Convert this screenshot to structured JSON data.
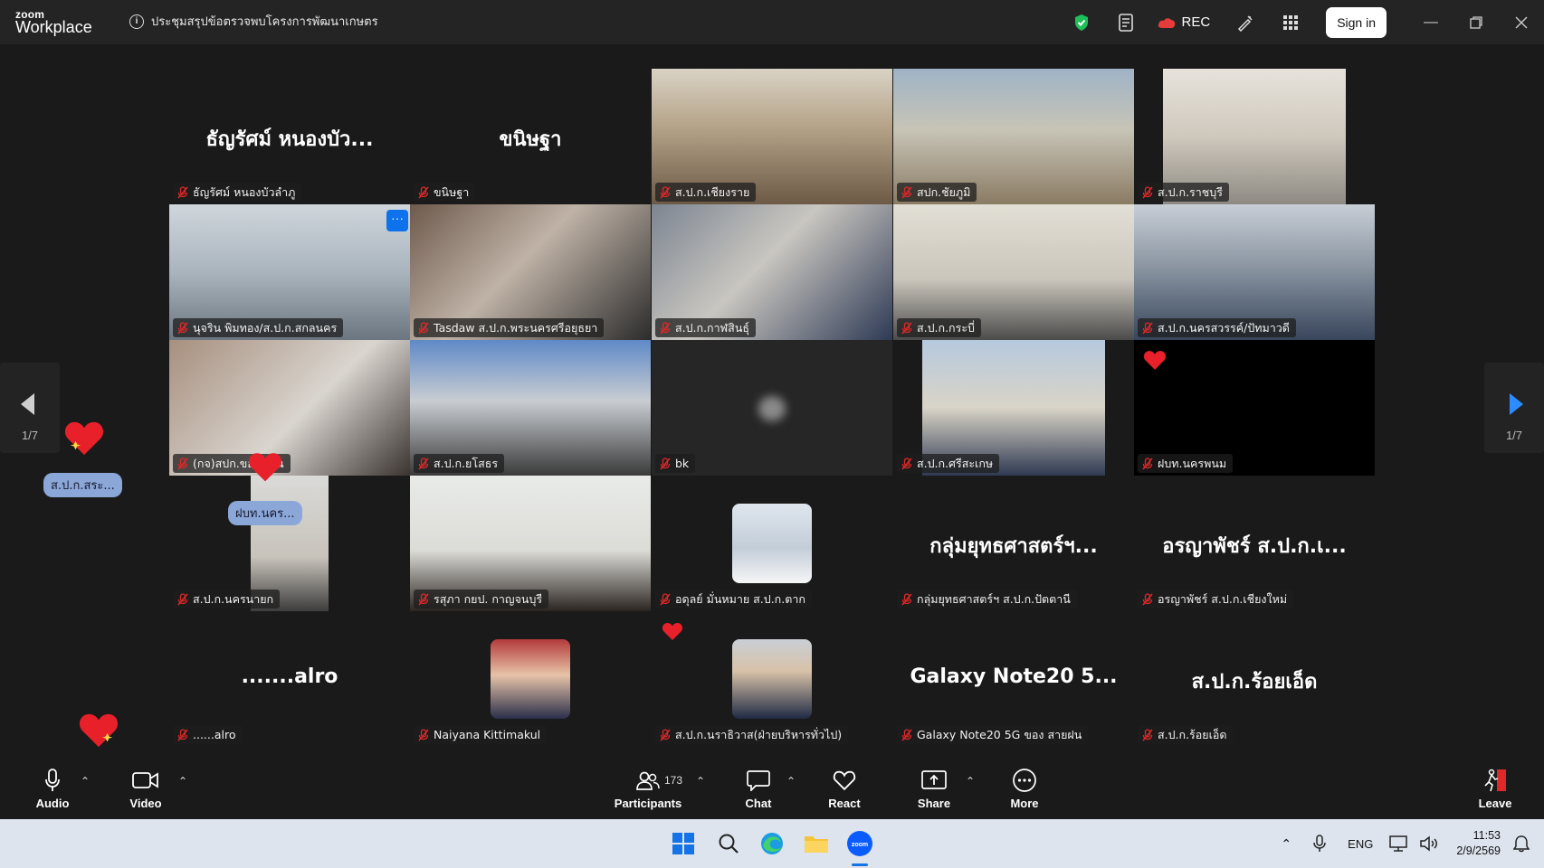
{
  "app": {
    "logo_line1": "zoom",
    "logo_line2": "Workplace",
    "meeting_title": "ประชุมสรุปข้อตรวจพบโครงการพัฒนาเกษตร",
    "rec_label": "REC",
    "sign_in_label": "Sign in"
  },
  "gallery": {
    "page_indicator_left": "1/7",
    "page_indicator_right": "1/7",
    "tiles": [
      {
        "name": "ธัญรัศม์ หนองบัวลำภู",
        "big_name": "ธัญรัศม์ หนองบัว...",
        "type": "name"
      },
      {
        "name": "ขนิษฐา",
        "big_name": "ขนิษฐา",
        "type": "name"
      },
      {
        "name": "ส.ป.ก.เชียงราย",
        "type": "video"
      },
      {
        "name": "สปก.ชัยภูมิ",
        "type": "video"
      },
      {
        "name": "ส.ป.ก.ราชบุรี",
        "type": "video"
      },
      {
        "name": "นุจริน พิมทอง/ส.ป.ก.สกลนคร",
        "type": "video"
      },
      {
        "name": "Tasdaw ส.ป.ก.พระนครศรีอยุธยา",
        "type": "video"
      },
      {
        "name": "ส.ป.ก.กาฬสินธุ์",
        "type": "video"
      },
      {
        "name": "ส.ป.ก.กระบี่",
        "type": "video"
      },
      {
        "name": "ส.ป.ก.นครสวรรค์/ปัทมาวดี",
        "type": "video"
      },
      {
        "name": "(กจ)สปก.ขอนแก่น",
        "type": "video"
      },
      {
        "name": "ส.ป.ก.ยโสธร",
        "type": "video"
      },
      {
        "name": "bk",
        "type": "blank"
      },
      {
        "name": "ส.ป.ก.ศรีสะเกษ",
        "type": "video"
      },
      {
        "name": "ฝบท.นครพนม",
        "type": "blank"
      },
      {
        "name": "ส.ป.ก.นครนายก",
        "type": "video"
      },
      {
        "name": "รสุภา กยป. กาญจนบุรี",
        "type": "video"
      },
      {
        "name": "อดุลย์ มั่นหมาย ส.ป.ก.ตาก",
        "type": "avatar"
      },
      {
        "name": "กลุ่มยุทธศาสตร์ฯ ส.ป.ก.ปัตตานี",
        "big_name": "กลุ่มยุทธศาสตร์ฯ...",
        "type": "name"
      },
      {
        "name": "อรญาพัชร์ ส.ป.ก.เชียงใหม่",
        "big_name": "อรญาพัชร์ ส.ป.ก.เ...",
        "type": "name"
      },
      {
        "name": "......alro",
        "big_name": ".......alro",
        "type": "name"
      },
      {
        "name": "Naiyana Kittimakul",
        "type": "avatar"
      },
      {
        "name": "ส.ป.ก.นราธิวาส(ฝ่ายบริหารทั่วไป)",
        "type": "avatar"
      },
      {
        "name": "Galaxy Note20 5G ของ สายฝน",
        "big_name": "Galaxy Note20 5...",
        "type": "name"
      },
      {
        "name": "ส.ป.ก.ร้อยเอ็ด",
        "big_name": "ส.ป.ก.ร้อยเอ็ด",
        "type": "name"
      }
    ],
    "floating_labels": {
      "left": "ส.ป.ก.สระ...",
      "tile": "ฝบท.นคร..."
    }
  },
  "toolbar": {
    "audio": "Audio",
    "video": "Video",
    "participants": "Participants",
    "participants_count": "173",
    "chat": "Chat",
    "react": "React",
    "share": "Share",
    "more": "More",
    "leave": "Leave"
  },
  "taskbar": {
    "lang": "ENG",
    "time": "11:53",
    "date": "2/9/2569"
  },
  "colors": {
    "accent_blue": "#0e72ed",
    "mute_red": "#e02828",
    "heart_red": "#e8202a"
  }
}
